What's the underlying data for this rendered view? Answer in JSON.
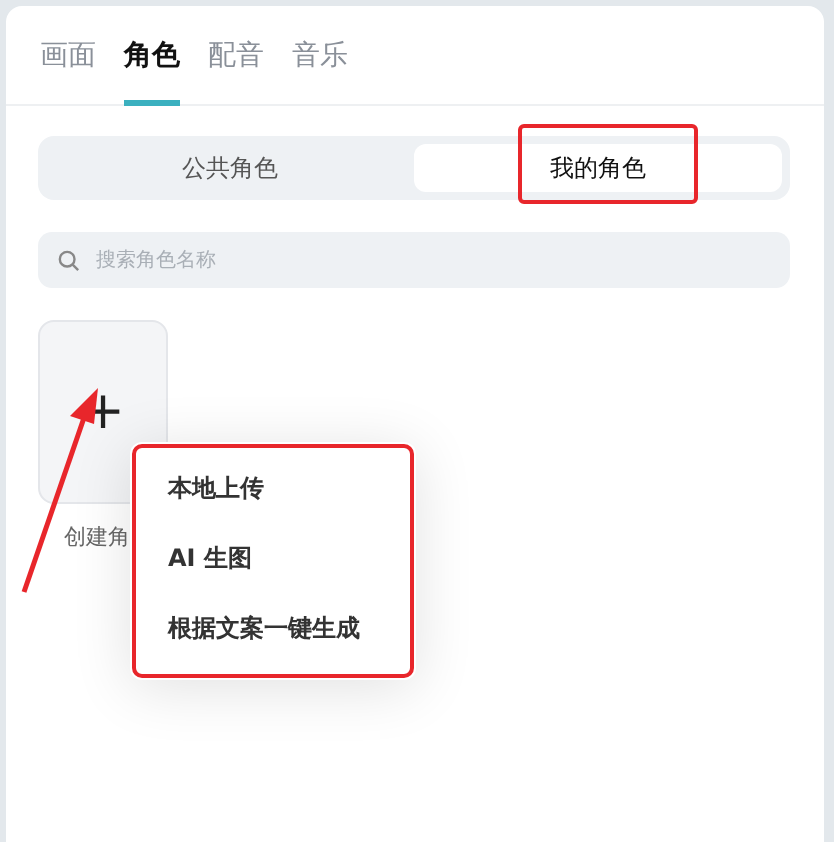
{
  "tabs": [
    {
      "label": "画面",
      "selected": false
    },
    {
      "label": "角色",
      "selected": true
    },
    {
      "label": "配音",
      "selected": false
    },
    {
      "label": "音乐",
      "selected": false
    }
  ],
  "segments": [
    {
      "label": "公共角色",
      "selected": false
    },
    {
      "label": "我的角色",
      "selected": true
    }
  ],
  "search": {
    "placeholder": "搜索角色名称"
  },
  "create_tile": {
    "icon": "+",
    "label": "创建角"
  },
  "menu": {
    "items": [
      {
        "label": "本地上传"
      },
      {
        "label": "AI 生图"
      },
      {
        "label": "根据文案一键生成"
      }
    ]
  }
}
